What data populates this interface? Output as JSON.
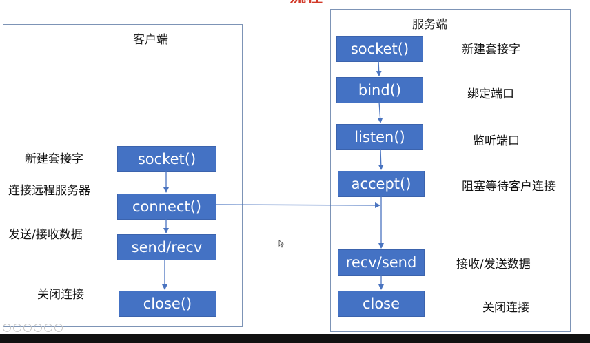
{
  "client": {
    "title": "客户端",
    "steps": [
      {
        "func": "socket()",
        "desc": "新建套接字"
      },
      {
        "func": "connect()",
        "desc": "连接远程服务器"
      },
      {
        "func": "send/recv",
        "desc": "发送/接收数据"
      },
      {
        "func": "close()",
        "desc": "关闭连接"
      }
    ]
  },
  "server": {
    "title": "服务端",
    "steps": [
      {
        "func": "socket()",
        "desc": "新建套接字"
      },
      {
        "func": "bind()",
        "desc": "绑定端口"
      },
      {
        "func": "listen()",
        "desc": "监听端口"
      },
      {
        "func": "accept()",
        "desc": "阻塞等待客户连接"
      },
      {
        "func": "recv/send",
        "desc": "接收/发送数据"
      },
      {
        "func": "close",
        "desc": "关闭连接"
      }
    ]
  },
  "colors": {
    "box": "#4472c4",
    "arrow": "#4a74c0",
    "border": "#7d94b6"
  }
}
